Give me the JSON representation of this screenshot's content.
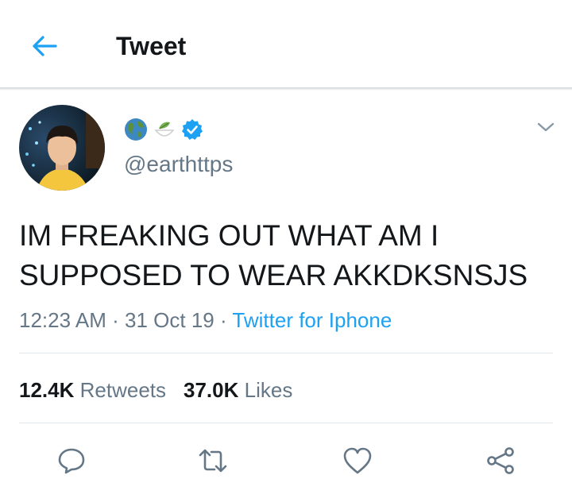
{
  "header": {
    "title": "Tweet"
  },
  "tweet": {
    "handle": "@earthttps",
    "text_line1": "IM FREAKING OUT WHAT AM I",
    "text_line2": "SUPPOSED TO WEAR AKKDKSNSJS",
    "time": "12:23 AM",
    "date": "31 Oct 19",
    "separator": "·",
    "source": "Twitter for Iphone",
    "icons": [
      "earth-globe-emoji",
      "seedling-bowl-emoji",
      "verified-badge-icon"
    ]
  },
  "stats": {
    "retweets_count": "12.4K",
    "retweets_label": "Retweets",
    "likes_count": "37.0K",
    "likes_label": "Likes"
  },
  "actions": [
    "reply-icon",
    "retweet-icon",
    "like-icon",
    "share-icon"
  ],
  "colors": {
    "accent": "#1da1f2",
    "secondary_text": "#657786",
    "divider": "#e1e8ed"
  }
}
